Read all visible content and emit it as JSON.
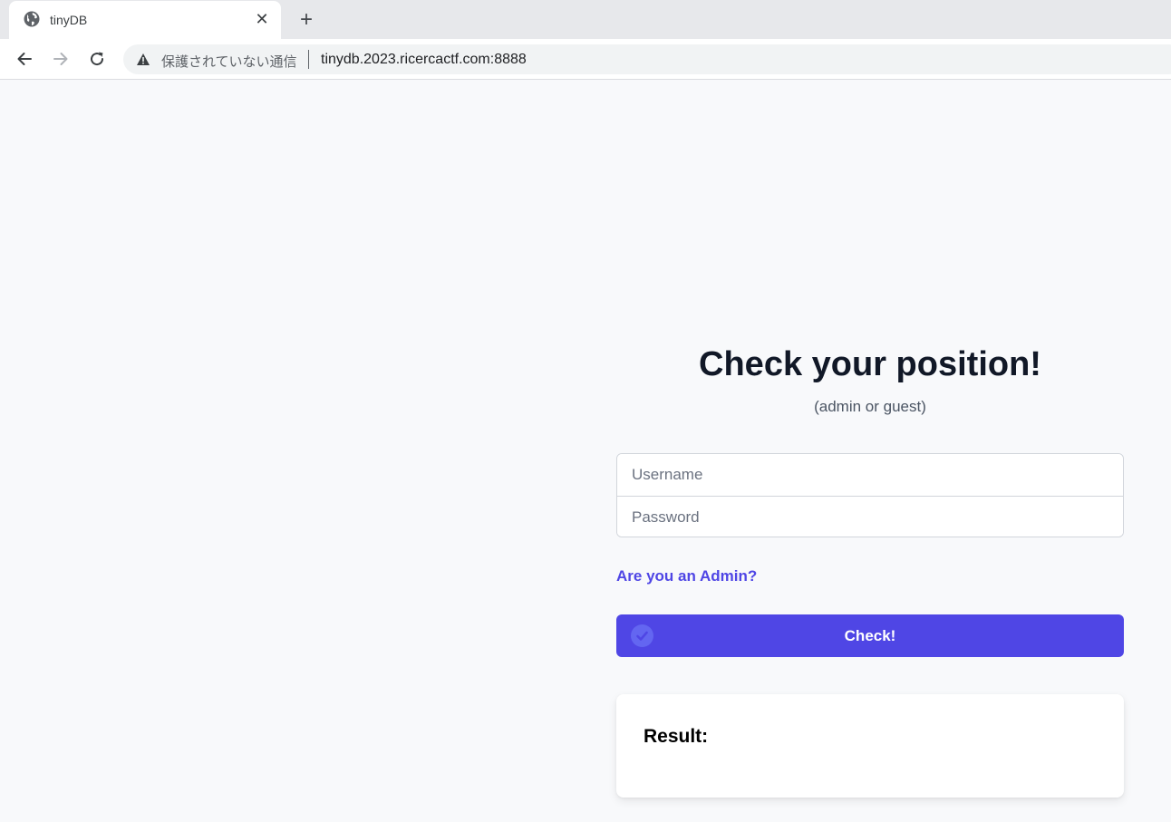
{
  "browser": {
    "tab": {
      "title": "tinyDB",
      "close_glyph": "✕",
      "icon": "globe-icon"
    },
    "new_tab_glyph": "+",
    "toolbar": {
      "back_icon": "arrow-left-icon",
      "forward_icon": "arrow-right-icon",
      "reload_icon": "reload-icon",
      "security_icon": "warning-triangle-icon",
      "security_text": "保護されていない通信",
      "url": "tinydb.2023.ricercactf.com:8888"
    }
  },
  "page": {
    "heading": "Check your position!",
    "subheading": "(admin or guest)",
    "form": {
      "username_placeholder": "Username",
      "password_placeholder": "Password",
      "admin_link": "Are you an Admin?",
      "submit_label": "Check!",
      "submit_icon": "check-circle-icon"
    },
    "result": {
      "label": "Result:",
      "value": ""
    }
  },
  "colors": {
    "accent": "#4f46e5",
    "page_background": "#f8f9fb",
    "heading": "#111827"
  }
}
